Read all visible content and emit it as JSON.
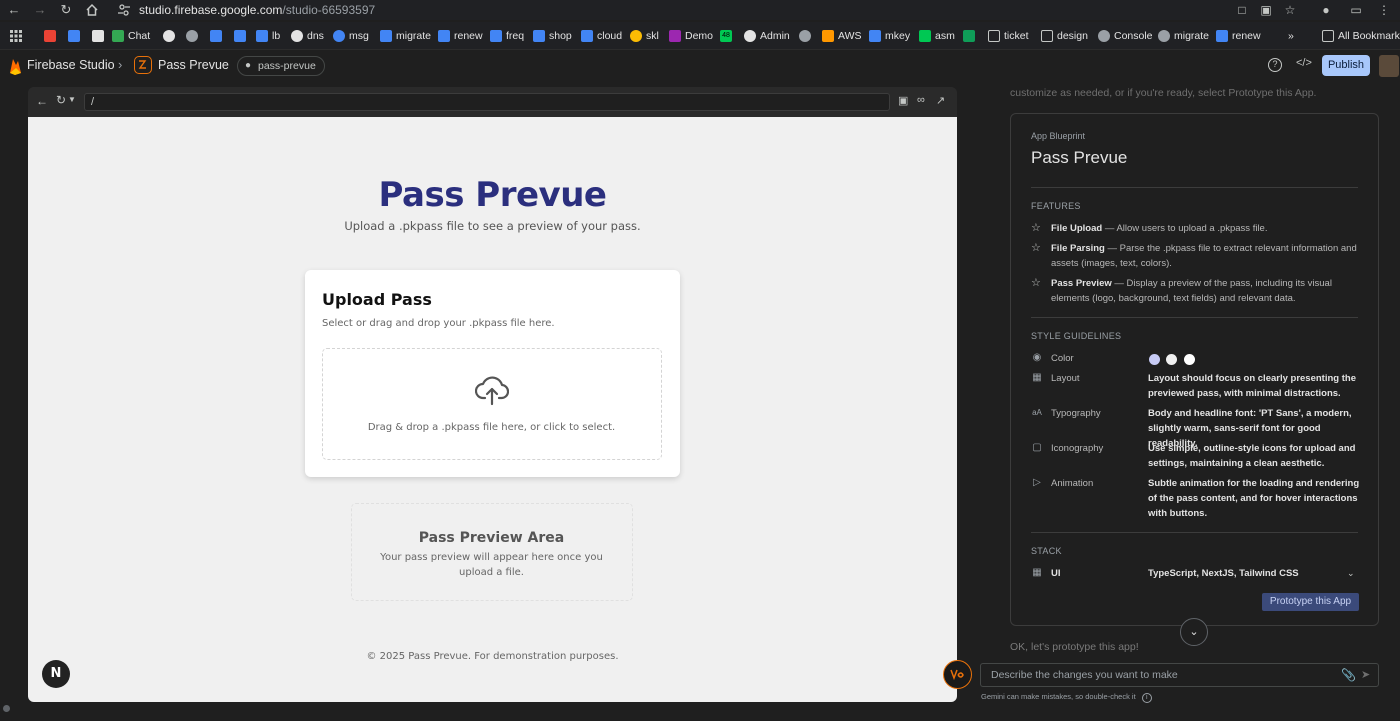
{
  "browser": {
    "url_host": "studio.firebase.google.com",
    "url_path": "/studio-66593597",
    "bookmarks": [
      {
        "label": "",
        "color": "#ea4335"
      },
      {
        "label": "",
        "color": "#4285f4"
      },
      {
        "label": "",
        "color": "#34a853"
      },
      {
        "label": "Chat",
        "color": "#34a853"
      },
      {
        "label": "",
        "color": "#4285f4"
      },
      {
        "label": "",
        "color": "#9aa0a6"
      },
      {
        "label": "",
        "color": "#4285f4"
      },
      {
        "label": "",
        "color": "#4285f4"
      },
      {
        "label": "lb",
        "color": "#9aa0a6"
      },
      {
        "label": "dns",
        "color": "#9aa0a6"
      },
      {
        "label": "msg",
        "color": "#4285f4"
      },
      {
        "label": "migrate",
        "color": "#4285f4"
      },
      {
        "label": "renew",
        "color": "#4285f4"
      },
      {
        "label": "freq",
        "color": "#4285f4"
      },
      {
        "label": "shop",
        "color": "#4285f4"
      },
      {
        "label": "cloud",
        "color": "#4285f4"
      },
      {
        "label": "skl",
        "color": "#4285f4"
      },
      {
        "label": "Demo",
        "color": "#9c27b0"
      },
      {
        "label": "",
        "color": "#00c853"
      },
      {
        "label": "Admin",
        "color": "#9aa0a6"
      },
      {
        "label": "",
        "color": "#9aa0a6"
      },
      {
        "label": "AWS",
        "color": "#ff9800"
      },
      {
        "label": "mkey",
        "color": "#4285f4"
      },
      {
        "label": "asm",
        "color": "#00c853"
      },
      {
        "label": "",
        "color": "#0f9d58"
      },
      {
        "label": "ticket",
        "color": "#9aa0a6"
      },
      {
        "label": "design",
        "color": "#9aa0a6"
      },
      {
        "label": "Console",
        "color": "#9aa0a6"
      },
      {
        "label": "migrate",
        "color": "#9aa0a6"
      },
      {
        "label": "renew",
        "color": "#4285f4"
      }
    ],
    "badge_48": "48",
    "all_bookmarks": "All Bookmarks",
    "more": "»"
  },
  "studio": {
    "brand": "Firebase Studio",
    "project": "Pass Prevue",
    "env_tag": "pass-prevue",
    "publish_label": "Publish"
  },
  "preview": {
    "address": "/"
  },
  "app": {
    "title": "Pass Prevue",
    "subtitle": "Upload a .pkpass file to see a preview of your pass.",
    "upload_title": "Upload Pass",
    "upload_desc": "Select or drag and drop your .pkpass file here.",
    "drop_text": "Drag & drop a .pkpass file here, or click to select.",
    "preview_title": "Pass Preview Area",
    "preview_desc": "Your pass preview will appear here once you upload a file.",
    "footer": "© 2025 Pass Prevue. For demonstration purposes.",
    "next_badge": "N",
    "title_color": "#2b2f7e"
  },
  "blueprint": {
    "faded_top": "customize as needed, or if you're ready, select Prototype this App.",
    "label": "App Blueprint",
    "name": "Pass Prevue",
    "features_heading": "FEATURES",
    "features": [
      {
        "name": "File Upload",
        "desc": " — Allow users to upload a .pkpass file."
      },
      {
        "name": "File Parsing",
        "desc": " — Parse the .pkpass file to extract relevant information and assets (images, text, colors)."
      },
      {
        "name": "Pass Preview",
        "desc": " — Display a preview of the pass, including its visual elements (logo, background, text fields) and relevant data."
      }
    ],
    "style_heading": "STYLE GUIDELINES",
    "style": {
      "color_label": "Color",
      "swatches": [
        "#c7cbf5",
        "#f0f0f0",
        "#ffffff"
      ],
      "layout_label": "Layout",
      "layout_value": "Layout should focus on clearly presenting the previewed pass, with minimal distractions.",
      "typography_label": "Typography",
      "typography_value": "Body and headline font: 'PT Sans', a modern, slightly warm, sans-serif font for good readability.",
      "iconography_label": "Iconography",
      "iconography_value": "Use simple, outline-style icons for upload and settings, maintaining a clean aesthetic.",
      "animation_label": "Animation",
      "animation_value": "Subtle animation for the loading and rendering of the pass content, and for hover interactions with buttons."
    },
    "stack_heading": "STACK",
    "stack_label": "UI",
    "stack_value": "TypeScript, NextJS, Tailwind CSS",
    "prototype_label": "Prototype this App"
  },
  "chat": {
    "ok_text": "OK, let's prototype this app!",
    "placeholder": "Describe the changes you want to make",
    "disclaimer": "Gemini can make mistakes, so double-check it"
  }
}
